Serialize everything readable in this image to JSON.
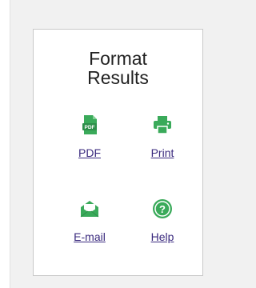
{
  "panel": {
    "title_line1": "Format",
    "title_line2": "Results"
  },
  "items": [
    {
      "label": "PDF",
      "icon": "pdf-file-icon"
    },
    {
      "label": "Print",
      "icon": "printer-icon"
    },
    {
      "label": "E-mail",
      "icon": "envelope-icon"
    },
    {
      "label": "Help",
      "icon": "help-circle-icon"
    }
  ],
  "colors": {
    "icon_green": "#3aaa5a",
    "link": "#3a2a7e",
    "title": "#222222",
    "panel_border": "#c8c8c8",
    "background": "#f1f1f1"
  }
}
